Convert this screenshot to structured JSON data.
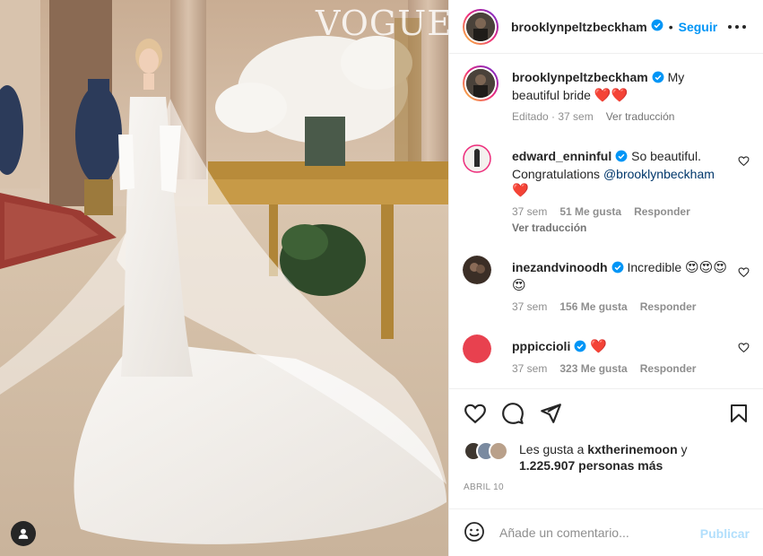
{
  "post": {
    "magazine_logo": "VOGUE",
    "author": "brooklynpeltzbeckham",
    "follow_label": "Seguir",
    "separator": "•"
  },
  "caption": {
    "username": "brooklynpeltzbeckham",
    "text": "My beautiful bride",
    "emoji": "❤️❤️",
    "edited": "Editado · 37 sem",
    "translate": "Ver traducción"
  },
  "comments": [
    {
      "username": "edward_enninful",
      "text": "So beautiful. Congratulations",
      "mention": "@brooklynbeckham",
      "emoji": "❤️",
      "time": "37 sem",
      "likes": "51 Me gusta",
      "reply": "Responder",
      "translate": "Ver traducción"
    },
    {
      "username": "inezandvinoodh",
      "text": "Incredible",
      "emoji": "😍😍😍😍",
      "time": "37 sem",
      "likes": "156 Me gusta",
      "reply": "Responder"
    },
    {
      "username": "pppiccioli",
      "text": "",
      "emoji": "❤️",
      "time": "37 sem",
      "likes": "323 Me gusta",
      "reply": "Responder"
    }
  ],
  "likes_summary": {
    "prefix": "Les gusta a ",
    "user": "kxtherinemoon",
    "connector": " y",
    "count": "1.225.907 personas más"
  },
  "date": "ABRIL 10",
  "comment_input": {
    "placeholder": "Añade un comentario...",
    "publish": "Publicar"
  },
  "icons": {
    "verified": "verified-badge-icon",
    "like": "heart-icon",
    "comment": "comment-icon",
    "share": "send-icon",
    "save": "bookmark-icon",
    "more": "more-options-icon",
    "emoji": "emoji-icon",
    "user_tag": "user-tag-icon"
  },
  "colors": {
    "accent": "#0095f6",
    "publish_disabled": "#b2dffc",
    "text": "#262626",
    "muted": "#8e8e8e",
    "mention": "#00376b",
    "heart": "#ed4956",
    "pppiccioli_avatar": "#e8414f"
  }
}
